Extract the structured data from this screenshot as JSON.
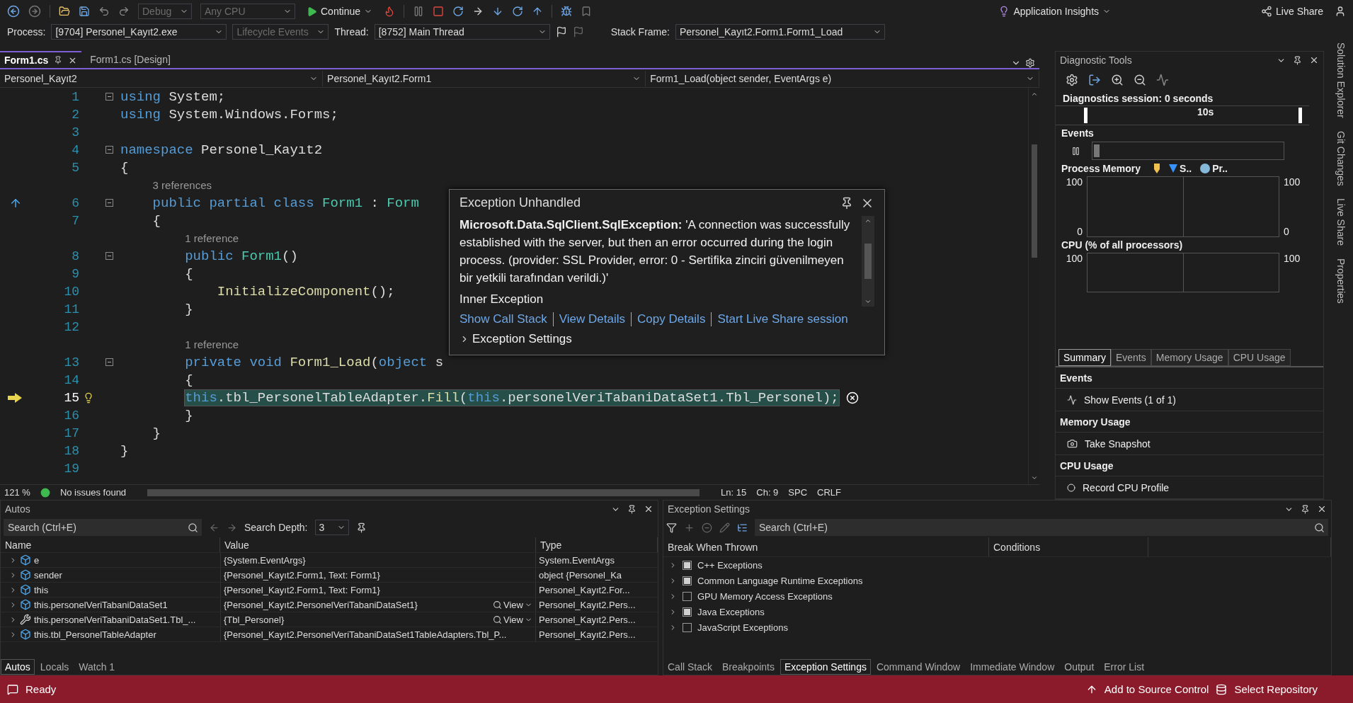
{
  "toolbar": {
    "dropdowns": [
      {
        "label": "Debug",
        "disabled": true
      },
      {
        "label": "Any CPU",
        "disabled": true
      }
    ],
    "continue": "Continue",
    "insights": "Application Insights",
    "live_share": "Live Share"
  },
  "debug_location": {
    "process_label": "Process:",
    "process": "[9704] Personel_Kayıt2.exe",
    "lifecycle": {
      "label": "Lifecycle Events",
      "disabled": true
    },
    "thread_label": "Thread:",
    "thread": "[8752] Main Thread",
    "frame_label": "Stack Frame:",
    "frame": "Personel_Kayıt2.Form1.Form1_Load"
  },
  "editor": {
    "tabs": [
      {
        "label": "Form1.cs",
        "selected": true
      },
      {
        "label": "Form1.cs [Design]",
        "selected": false
      }
    ],
    "nav": [
      "Personel_Kayıt2",
      "Personel_Kayıt2.Form1",
      "Form1_Load(object sender, EventArgs e)"
    ],
    "lines": [
      {
        "number": "1",
        "foldable": true,
        "tokens": [
          {
            "kind": "kw",
            "text": "using"
          },
          {
            "kind": "plain",
            "text": " System;"
          }
        ]
      },
      {
        "number": "2",
        "tokens": [
          {
            "kind": "kw",
            "text": "using"
          },
          {
            "kind": "plain",
            "text": " System.Windows.Forms;"
          }
        ]
      },
      {
        "number": "3"
      },
      {
        "number": "4",
        "foldable": true,
        "tokens": [
          {
            "kind": "kw",
            "text": "namespace"
          },
          {
            "kind": "plain",
            "text": " Personel_Kayıt2"
          }
        ]
      },
      {
        "number": "5",
        "tokens": [
          {
            "kind": "plain",
            "text": "{"
          }
        ],
        "children": [
          {
            "number": "6",
            "foldable": true,
            "kind": "inheritance",
            "lens": "3 references",
            "tokens": [
              {
                "kind": "kw",
                "text": "public partial class"
              },
              {
                "kind": "type",
                "text": " Form1"
              },
              {
                "kind": "plain",
                "text": " : "
              },
              {
                "kind": "type",
                "text": "Form"
              }
            ]
          },
          {
            "number": "7",
            "tokens": [
              {
                "kind": "plain",
                "text": "{"
              }
            ],
            "children": [
              {
                "number": "8",
                "foldable": true,
                "lens": "1 reference",
                "tokens": [
                  {
                    "kind": "kw",
                    "text": "public"
                  },
                  {
                    "kind": "type",
                    "text": " Form1"
                  },
                  {
                    "kind": "plain",
                    "text": "()"
                  }
                ]
              },
              {
                "number": "9",
                "tokens": [
                  {
                    "kind": "plain",
                    "text": "{"
                  }
                ],
                "children": [
                  {
                    "number": "10",
                    "tokens": [
                      {
                        "kind": "method",
                        "text": "InitializeComponent"
                      },
                      {
                        "kind": "plain",
                        "text": "();"
                      }
                    ]
                  }
                ]
              },
              {
                "number": "11",
                "tokens": [
                  {
                    "kind": "plain",
                    "text": "}"
                  }
                ]
              },
              {
                "number": "12"
              },
              {
                "number": "13",
                "foldable": true,
                "lens": "1 reference",
                "tokens": [
                  {
                    "kind": "kw",
                    "text": "private void"
                  },
                  {
                    "kind": "method",
                    "text": " Form1_Load"
                  },
                  {
                    "kind": "plain",
                    "text": "("
                  },
                  {
                    "kind": "kw",
                    "text": "object"
                  },
                  {
                    "kind": "plain",
                    "text": " s"
                  }
                ]
              },
              {
                "number": "14",
                "tokens": [
                  {
                    "kind": "plain",
                    "text": "{"
                  }
                ]
              },
              {
                "number": "15",
                "current": true,
                "tokens": [
                  {
                    "kind": "kw",
                    "text": "this"
                  },
                  {
                    "kind": "plain",
                    "text": ".tbl_PersonelTableAdapter."
                  },
                  {
                    "kind": "method",
                    "text": "Fill"
                  },
                  {
                    "kind": "plain",
                    "text": "("
                  },
                  {
                    "kind": "kw",
                    "text": "this"
                  },
                  {
                    "kind": "plain",
                    "text": ".personelVeriTabaniDataSet1.Tbl_Personel);"
                  }
                ]
              },
              {
                "number": "16",
                "tokens": [
                  {
                    "kind": "plain",
                    "text": "}"
                  }
                ]
              }
            ]
          },
          {
            "number": "17",
            "tokens": [
              {
                "kind": "plain",
                "text": "}"
              }
            ]
          }
        ]
      },
      {
        "number": "18",
        "tokens": [
          {
            "kind": "plain",
            "text": "}"
          }
        ]
      },
      {
        "number": "19"
      }
    ],
    "status": {
      "zoom": "121 %",
      "issues": "No issues found",
      "line": "Ln: 15",
      "column": "Ch: 9",
      "whitespace": "SPC",
      "line_ending": "CRLF"
    }
  },
  "exception_popup": {
    "title": "Exception Unhandled",
    "message": "**Microsoft.Data.SqlClient.SqlException:** 'A connection was successfully established with the server, but then an error occurred during the login process. (provider: SSL Provider, error: 0 - Sertifika zinciri güvenilmeyen bir yetkili tarafından verildi.)'",
    "inner": "Inner Exception",
    "links": [
      "Show Call Stack",
      "View Details",
      "Copy Details",
      "Start Live Share session"
    ],
    "settings": {
      "label": "Exception Settings",
      "expanded": false
    }
  },
  "diagnostic_tools": {
    "title": "Diagnostic Tools",
    "session": "Diagnostics session: 0 seconds",
    "timeline_label": "10s",
    "events_label": "Events",
    "memory": {
      "label": "Process Memory",
      "legend": [
        {
          "kind": "marker",
          "color": "#f2c14e"
        },
        {
          "kind": "triangle",
          "label": "S..",
          "color": "#3794ff"
        },
        {
          "kind": "dot",
          "label": "Pr..",
          "color": "#86b9d9"
        }
      ],
      "left_axis": [
        "100",
        "0"
      ],
      "right_axis": [
        "100",
        "0"
      ]
    },
    "cpu": {
      "label": "CPU (% of all processors)",
      "left_axis": [
        "100"
      ],
      "right_axis": [
        "100"
      ]
    },
    "tabs": [
      {
        "label": "Summary",
        "selected": true
      },
      {
        "label": "Events",
        "selected": false
      },
      {
        "label": "Memory Usage",
        "selected": false
      },
      {
        "label": "CPU Usage",
        "selected": false
      }
    ],
    "sections": [
      {
        "title": "Events",
        "action": "Show Events (1 of 1)"
      },
      {
        "title": "Memory Usage",
        "action": "Take Snapshot"
      },
      {
        "title": "CPU Usage",
        "action": "Record CPU Profile"
      }
    ]
  },
  "side_tabs": [
    "Solution Explorer",
    "Git Changes",
    "Live Share",
    "Properties"
  ],
  "autos": {
    "title": "Autos",
    "search_placeholder": "Search (Ctrl+E)",
    "depth_label": "Search Depth:",
    "depth": "3",
    "columns": [
      "Name",
      "Value",
      "Type"
    ],
    "rows": [
      {
        "kind": "object",
        "name": "e",
        "value": "{System.EventArgs}",
        "type": "System.EventArgs",
        "view": false
      },
      {
        "kind": "object",
        "name": "sender",
        "value": "{Personel_Kayıt2.Form1, Text: Form1}",
        "type": "object {Personel_Ka",
        "view": false
      },
      {
        "kind": "object",
        "name": "this",
        "value": "{Personel_Kayıt2.Form1, Text: Form1}",
        "type": "Personel_Kayıt2.For...",
        "view": false
      },
      {
        "kind": "locked",
        "name": "this.personelVeriTabaniDataSet1",
        "value": "{Personel_Kayıt2.PersonelVeriTabaniDataSet1}",
        "type": "Personel_Kayıt2.Pers...",
        "view": true,
        "view_label": "View"
      },
      {
        "kind": "property",
        "name": "this.personelVeriTabaniDataSet1.Tbl_...",
        "value": "{Tbl_Personel}",
        "type": "Personel_Kayıt2.Pers...",
        "view": true,
        "view_label": "View"
      },
      {
        "kind": "locked",
        "name": "this.tbl_PersonelTableAdapter",
        "value": "{Personel_Kayıt2.PersonelVeriTabaniDataSet1TableAdapters.Tbl_P...",
        "type": "Personel_Kayıt2.Pers...",
        "view": false
      }
    ],
    "tabs": [
      {
        "label": "Autos",
        "selected": true
      },
      {
        "label": "Locals",
        "selected": false
      },
      {
        "label": "Watch 1",
        "selected": false
      }
    ]
  },
  "exception_settings": {
    "title": "Exception Settings",
    "search_placeholder": "Search (Ctrl+E)",
    "columns": [
      "Break When Thrown",
      "Conditions"
    ],
    "rows": [
      {
        "label": "C++ Exceptions",
        "checked": true
      },
      {
        "label": "Common Language Runtime Exceptions",
        "checked": true
      },
      {
        "label": "GPU Memory Access Exceptions",
        "checked": false
      },
      {
        "label": "Java Exceptions",
        "checked": true
      },
      {
        "label": "JavaScript Exceptions",
        "checked": false
      }
    ],
    "tabs": [
      {
        "label": "Call Stack",
        "selected": false
      },
      {
        "label": "Breakpoints",
        "selected": false
      },
      {
        "label": "Exception Settings",
        "selected": true
      },
      {
        "label": "Command Window",
        "selected": false
      },
      {
        "label": "Immediate Window",
        "selected": false
      },
      {
        "label": "Output",
        "selected": false
      },
      {
        "label": "Error List",
        "selected": false
      }
    ]
  },
  "status_bar": {
    "state": "Ready",
    "source_control": "Add to Source Control",
    "repository": "Select Repository"
  }
}
